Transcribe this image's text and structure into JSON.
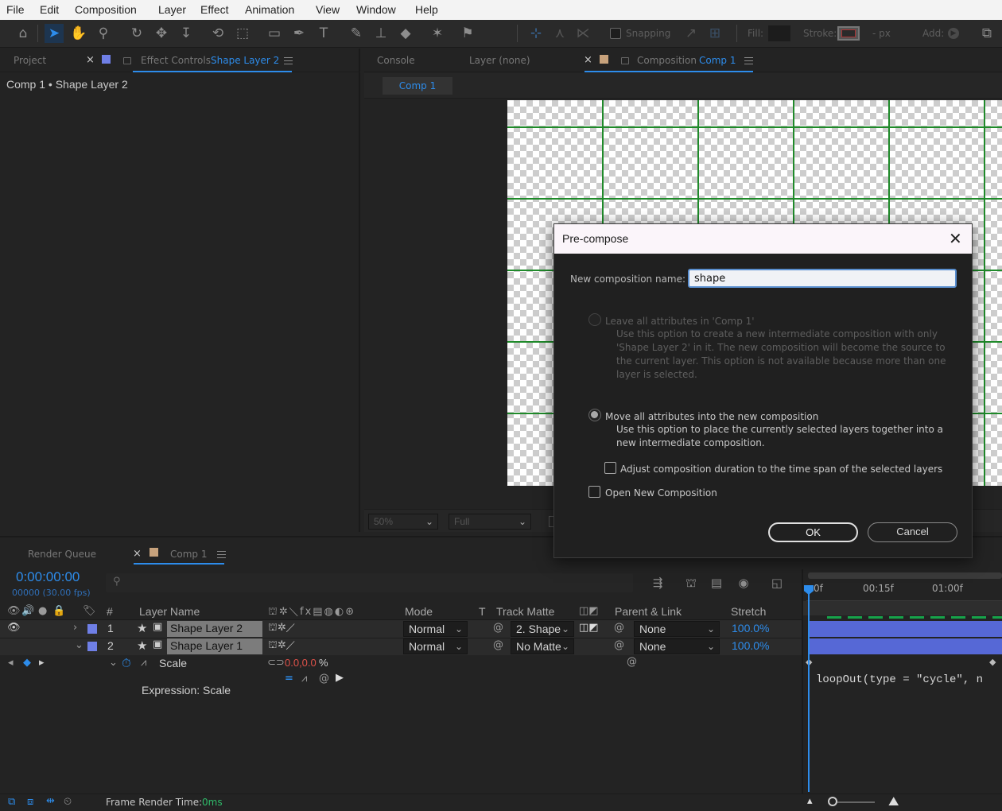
{
  "menu": [
    "File",
    "Edit",
    "Composition",
    "Layer",
    "Effect",
    "Animation",
    "View",
    "Window",
    "Help"
  ],
  "toolbar": {
    "tools": [
      "home-icon",
      "selection-tool-icon",
      "hand-tool-icon",
      "zoom-tool-icon",
      "orbit-camera-icon",
      "pan-camera-icon",
      "dolly-camera-icon",
      "rotate-tool-icon",
      "pan-behind-icon",
      "rectangle-tool-icon",
      "pen-tool-icon",
      "type-tool-icon",
      "brush-tool-icon",
      "clone-stamp-icon",
      "eraser-icon",
      "roto-brush-icon",
      "puppet-pin-icon"
    ],
    "snapping_label": "Snapping",
    "fill_label": "Fill:",
    "stroke_label": "Stroke:",
    "stroke_unit": "- px",
    "add_label": "Add:"
  },
  "left_panel": {
    "tab_project": "Project",
    "tab_effect_controls": "Effect Controls",
    "tab_effect_controls_target": "Shape Layer 2",
    "breadcrumb": "Comp 1 • Shape Layer 2"
  },
  "comp_panel": {
    "tab_console": "Console",
    "tab_layer": "Layer (none)",
    "tab_composition": "Composition",
    "tab_composition_target": "Comp 1",
    "sub_tab": "Comp 1",
    "zoom": "50%",
    "resolution": "Full"
  },
  "dialog": {
    "title": "Pre-compose",
    "name_label": "New composition name:",
    "name_value": "shape",
    "option1_label": "Leave all attributes in 'Comp 1'",
    "option1_desc": "Use this option to create a new intermediate composition with only 'Shape Layer 2' in it. The new composition will become the source to the current layer. This option is not available because more than one layer is selected.",
    "option2_label": "Move all attributes into the new composition",
    "option2_desc": "Use this option to place the currently selected layers together into a new intermediate composition.",
    "adjust_duration_label": "Adjust composition duration to the time span of the selected layers",
    "open_new_label": "Open New Composition",
    "ok_label": "OK",
    "cancel_label": "Cancel"
  },
  "timeline": {
    "tab_render_queue": "Render Queue",
    "tab_comp": "Comp 1",
    "timecode": "0:00:00:00",
    "frames": "00000 (30.00 fps)",
    "columns": {
      "number": "#",
      "layer_name": "Layer Name",
      "mode": "Mode",
      "t": "T",
      "track_matte": "Track Matte",
      "parent": "Parent & Link",
      "stretch": "Stretch"
    },
    "ruler": [
      "0f",
      "00:15f",
      "01:00f"
    ],
    "layers": [
      {
        "index": "1",
        "name": "Shape Layer 2",
        "mode": "Normal",
        "matte": "2. Shape",
        "parent": "None",
        "stretch": "100.0%",
        "color": "#6f7fe6"
      },
      {
        "index": "2",
        "name": "Shape Layer 1",
        "mode": "Normal",
        "matte": "No Matte",
        "parent": "None",
        "stretch": "100.0%",
        "color": "#6f7fe6"
      }
    ],
    "property": {
      "name": "Scale",
      "value": "0.0,0.0",
      "unit": "%"
    },
    "expression_label": "Expression: Scale",
    "expression_text": "loopOut(type = \"cycle\", n",
    "frame_render_label": "Frame Render Time:",
    "frame_render_value": "0ms"
  },
  "colors": {
    "accent": "#2d8ceb",
    "label_blue": "#6f7fe6",
    "label_tan": "#c7a27c",
    "grid_green": "#1f8a2a",
    "value_red": "#e0524a"
  }
}
